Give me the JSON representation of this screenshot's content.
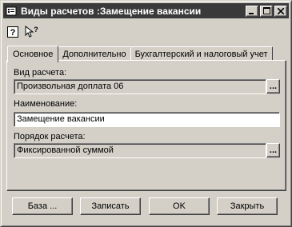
{
  "window": {
    "title": "Виды расчетов :Замещение вакансии"
  },
  "toolbar": {
    "help_icon": "help-icon",
    "whats_this_icon": "whats-this-icon"
  },
  "tabs": [
    {
      "label": "Основное",
      "active": true
    },
    {
      "label": "Дополнительно",
      "active": false
    },
    {
      "label": "Бухгалтерский и налоговый учет",
      "active": false
    }
  ],
  "form": {
    "calc_type_label": "Вид расчета:",
    "calc_type_value": "Произвольная доплата 06",
    "name_label": "Наименование:",
    "name_value": "Замещение вакансии",
    "order_label": "Порядок расчета:",
    "order_value": "Фиксированной суммой",
    "select_button_label": "..."
  },
  "buttons": {
    "base": "База ...",
    "save": "Записать",
    "ok": "OK",
    "close": "Закрыть"
  },
  "colors": {
    "face": "#d4d0c8",
    "titlebar": "#3a3a3a",
    "input": "#ffffff"
  }
}
